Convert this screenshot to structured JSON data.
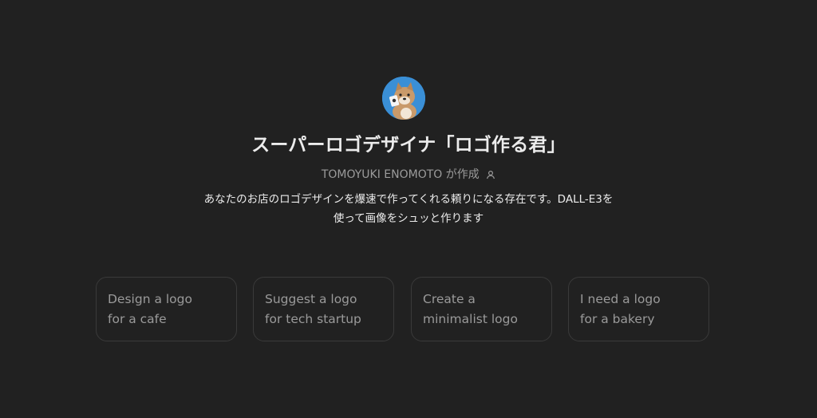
{
  "gpt": {
    "title": "スーパーロゴデザイナ「ロゴ作る君」",
    "author": "TOMOYUKI ENOMOTO が作成",
    "description_lines": [
      "あなたのお店のロゴデザインを爆速で作ってくれる頼りになる存在です。DALL-E3を",
      "使って画像をシュッと作ります"
    ]
  },
  "conversation_starters": [
    {
      "line1": "Design a logo",
      "line2": "for a cafe"
    },
    {
      "line1": "Suggest a logo",
      "line2": "for tech startup"
    },
    {
      "line1": "Create a",
      "line2": "minimalist logo"
    },
    {
      "line1": "I need a logo",
      "line2": "for a bakery"
    }
  ],
  "colors": {
    "background": "#212121",
    "avatar_bg": "#3a8fd6",
    "title": "#ececec",
    "muted": "#9b9b9b",
    "card_border": "#3a3a3a"
  },
  "icons": {
    "avatar": "shiba-dog-avatar",
    "author": "person-icon"
  }
}
